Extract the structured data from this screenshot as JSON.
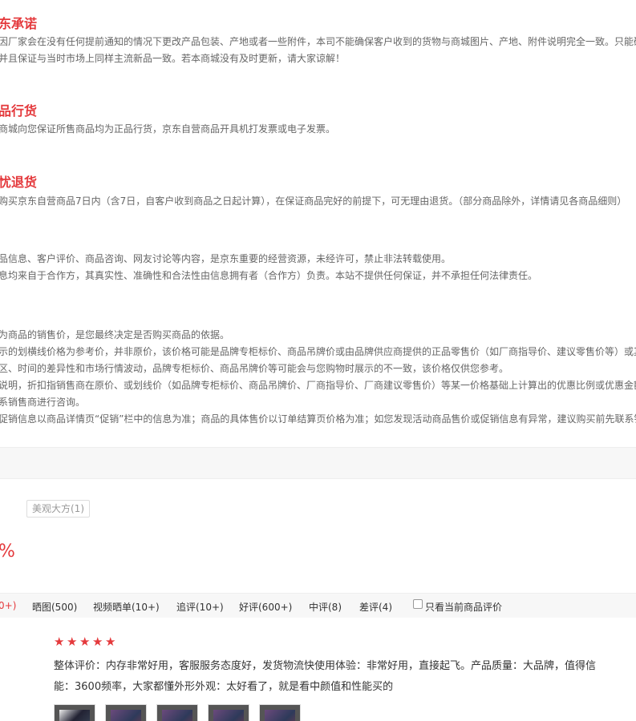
{
  "sections": [
    {
      "title": "东承诺",
      "lines": [
        "因厂家会在没有任何提前通知的情况下更改产品包装、产地或者一些附件，本司不能确保客户收到的货物与商城图片、产地、附件说明完全一致。只能确",
        "并且保证与当时市场上同样主流新品一致。若本商城没有及时更新，请大家谅解！"
      ]
    },
    {
      "title": "品行货",
      "lines": [
        "商城向您保证所售商品均为正品行货，京东自营商品开具机打发票或电子发票。"
      ]
    },
    {
      "title": "忧退货",
      "lines": [
        "购买京东自营商品7日内（含7日，自客户收到商品之日起计算），在保证商品完好的前提下，可无理由退货。（部分商品除外，详情请见各商品细则）"
      ]
    },
    {
      "title": "",
      "lines": [
        "品信息、客户评价、商品咨询、网友讨论等内容，是京东重要的经营资源，未经许可，禁止非法转载使用。",
        "息均来自于合作方，其真实性、准确性和合法性由信息拥有者（合作方）负责。本站不提供任何保证，并不承担任何法律责任。"
      ]
    },
    {
      "title": "",
      "lines": [
        "为商品的销售价，是您最终决定是否购买商品的依据。",
        "示的划横线价格为参考价，并非原价，该价格可能是品牌专柜标价、商品吊牌价或由品牌供应商提供的正品零售价（如厂商指导价、建议零售价等）或其",
        "区、时间的差异性和市场行情波动，品牌专柜标价、商品吊牌价等可能会与您购物时展示的不一致，该价格仅供您参考。",
        "说明，折扣指销售商在原价、或划线价（如品牌专柜标价、商品吊牌价、厂商指导价、厂商建议零售价）等某一价格基础上计算出的优惠比例或优惠金额",
        "系销售商进行咨询。",
        "促销信息以商品详情页“促销”栏中的信息为准；商品的具体售价以订单结算页价格为准；如您发现活动商品售价或促销信息有异常，建议购买前先联系销"
      ]
    }
  ],
  "tag": "美观大方(1)",
  "rate": "%",
  "filters": [
    {
      "label": "0+)",
      "active": true
    },
    {
      "label": "晒图(500)",
      "active": false
    },
    {
      "label": "视频晒单(10+)",
      "active": false
    },
    {
      "label": "追评(10+)",
      "active": false
    },
    {
      "label": "好评(600+)",
      "active": false
    },
    {
      "label": "中评(8)",
      "active": false
    },
    {
      "label": "差评(4)",
      "active": false
    }
  ],
  "only_current_label": "只看当前商品评价",
  "review": {
    "stars": 5,
    "line1": "整体评价：内存非常好用，客服服务态度好，发货物流快使用体验：非常好用，直接起飞。产品质量：大品牌，值得信",
    "line2": "能：3600频率，大家都懂外形外观：太好看了，就是看中颜值和性能买的"
  },
  "colors": {
    "accent": "#e4393c",
    "text": "#666666"
  }
}
